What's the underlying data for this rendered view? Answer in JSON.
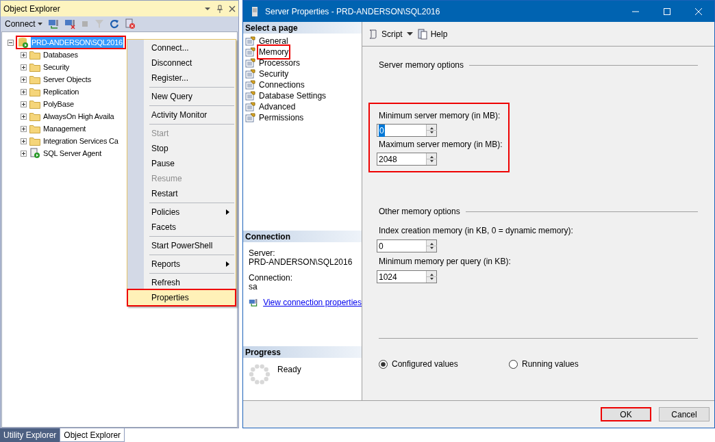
{
  "object_explorer": {
    "title": "Object Explorer",
    "connect_label": "Connect",
    "server_node": {
      "label": "PRD-ANDERSON\\SQL2016",
      "expanded": true,
      "selected": true,
      "highlighted": true
    },
    "nodes": [
      {
        "label": "Databases",
        "kind": "folder"
      },
      {
        "label": "Security",
        "kind": "folder"
      },
      {
        "label": "Server Objects",
        "kind": "folder"
      },
      {
        "label": "Replication",
        "kind": "folder"
      },
      {
        "label": "PolyBase",
        "kind": "folder"
      },
      {
        "label": "AlwaysOn High Availa",
        "kind": "folder"
      },
      {
        "label": "Management",
        "kind": "folder"
      },
      {
        "label": "Integration Services Ca",
        "kind": "folder"
      },
      {
        "label": "SQL Server Agent",
        "kind": "agent"
      }
    ]
  },
  "context_menu": [
    {
      "kind": "item",
      "label": "Connect...",
      "disabled": false,
      "submenu": false,
      "selected": false
    },
    {
      "kind": "item",
      "label": "Disconnect",
      "disabled": false,
      "submenu": false,
      "selected": false
    },
    {
      "kind": "item",
      "label": "Register...",
      "disabled": false,
      "submenu": false,
      "selected": false
    },
    {
      "kind": "separator"
    },
    {
      "kind": "item",
      "label": "New Query",
      "disabled": false,
      "submenu": false,
      "selected": false
    },
    {
      "kind": "separator"
    },
    {
      "kind": "item",
      "label": "Activity Monitor",
      "disabled": false,
      "submenu": false,
      "selected": false
    },
    {
      "kind": "separator"
    },
    {
      "kind": "item",
      "label": "Start",
      "disabled": true,
      "submenu": false,
      "selected": false
    },
    {
      "kind": "item",
      "label": "Stop",
      "disabled": false,
      "submenu": false,
      "selected": false
    },
    {
      "kind": "item",
      "label": "Pause",
      "disabled": false,
      "submenu": false,
      "selected": false
    },
    {
      "kind": "item",
      "label": "Resume",
      "disabled": true,
      "submenu": false,
      "selected": false
    },
    {
      "kind": "item",
      "label": "Restart",
      "disabled": false,
      "submenu": false,
      "selected": false
    },
    {
      "kind": "separator"
    },
    {
      "kind": "item",
      "label": "Policies",
      "disabled": false,
      "submenu": true,
      "selected": false
    },
    {
      "kind": "item",
      "label": "Facets",
      "disabled": false,
      "submenu": false,
      "selected": false
    },
    {
      "kind": "separator"
    },
    {
      "kind": "item",
      "label": "Start PowerShell",
      "disabled": false,
      "submenu": false,
      "selected": false
    },
    {
      "kind": "separator"
    },
    {
      "kind": "item",
      "label": "Reports",
      "disabled": false,
      "submenu": true,
      "selected": false
    },
    {
      "kind": "separator"
    },
    {
      "kind": "item",
      "label": "Refresh",
      "disabled": false,
      "submenu": false,
      "selected": false
    },
    {
      "kind": "item",
      "label": "Properties",
      "disabled": false,
      "submenu": false,
      "selected": true
    }
  ],
  "bottom_tabs": [
    {
      "label": "Utility Explorer",
      "selected": false
    },
    {
      "label": "Object Explorer",
      "selected": true
    }
  ],
  "dialog": {
    "title": "Server Properties - PRD-ANDERSON\\SQL2016",
    "select_page_header": "Select a page",
    "pages": [
      {
        "label": "General",
        "selected": false
      },
      {
        "label": "Memory",
        "selected": true
      },
      {
        "label": "Processors",
        "selected": false
      },
      {
        "label": "Security",
        "selected": false
      },
      {
        "label": "Connections",
        "selected": false
      },
      {
        "label": "Database Settings",
        "selected": false
      },
      {
        "label": "Advanced",
        "selected": false
      },
      {
        "label": "Permissions",
        "selected": false
      }
    ],
    "connection": {
      "header": "Connection",
      "server_label": "Server:",
      "server": "PRD-ANDERSON\\SQL2016",
      "connection_label": "Connection:",
      "connection": "sa",
      "link": "View connection properties"
    },
    "progress": {
      "header": "Progress",
      "status": "Ready"
    },
    "toolbar": {
      "script": "Script",
      "help": "Help"
    },
    "server_memory": {
      "title": "Server memory options",
      "highlighted": true,
      "fields": [
        {
          "label": "Minimum server memory (in MB):",
          "value": "0",
          "selected": true
        },
        {
          "label": "Maximum server memory (in MB):",
          "value": "2048",
          "selected": false
        }
      ]
    },
    "other_memory": {
      "title": "Other memory options",
      "fields": [
        {
          "label": "Index creation memory (in KB, 0 = dynamic memory):",
          "value": "0",
          "selected": false
        },
        {
          "label": "Minimum memory per query (in KB):",
          "value": "1024",
          "selected": false
        }
      ]
    },
    "value_mode": [
      {
        "label": "Configured values",
        "selected": true
      },
      {
        "label": "Running values",
        "selected": false
      }
    ],
    "buttons": [
      {
        "label": "OK",
        "highlighted": true
      },
      {
        "label": "Cancel",
        "highlighted": false
      }
    ]
  }
}
